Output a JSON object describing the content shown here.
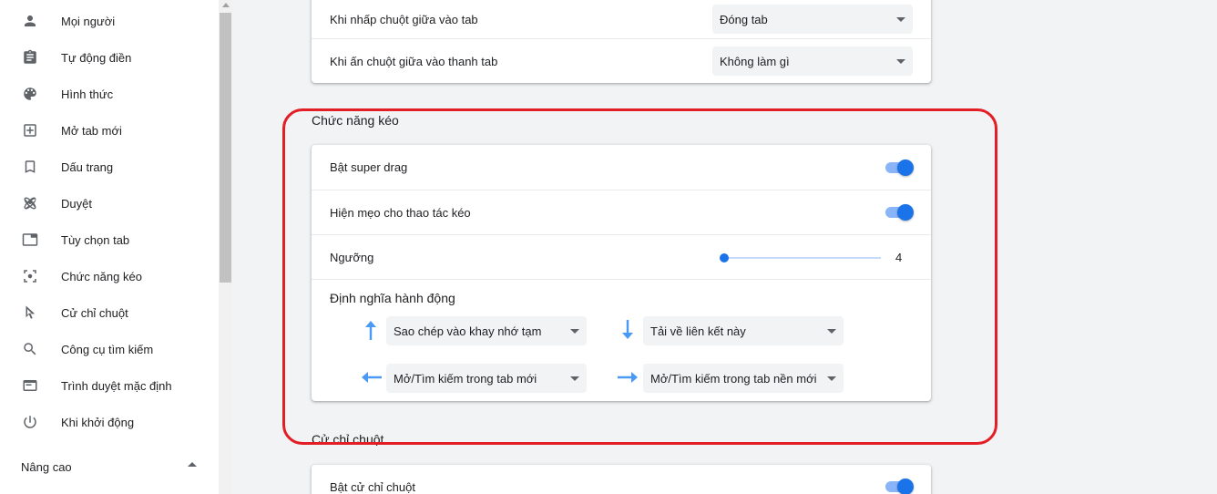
{
  "sidebar": {
    "items": [
      {
        "label": "Mọi người",
        "icon": "person-icon"
      },
      {
        "label": "Tự động điền",
        "icon": "clipboard-icon"
      },
      {
        "label": "Hình thức",
        "icon": "palette-icon"
      },
      {
        "label": "Mở tab mới",
        "icon": "new-tab-icon"
      },
      {
        "label": "Dấu trang",
        "icon": "bookmark-icon"
      },
      {
        "label": "Duyệt",
        "icon": "atom-icon"
      },
      {
        "label": "Tùy chọn tab",
        "icon": "tab-icon"
      },
      {
        "label": "Chức năng kéo",
        "icon": "drag-select-icon"
      },
      {
        "label": "Cử chỉ chuột",
        "icon": "cursor-icon"
      },
      {
        "label": "Công cụ tìm kiếm",
        "icon": "search-icon"
      },
      {
        "label": "Trình duyệt mặc định",
        "icon": "browser-icon"
      },
      {
        "label": "Khi khởi động",
        "icon": "power-icon"
      }
    ],
    "advanced_label": "Nâng cao"
  },
  "tabs_card": {
    "middle_click_tab_label": "Khi nhấp chuột giữa vào tab",
    "middle_click_tab_value": "Đóng tab",
    "middle_click_bar_label": "Khi ấn chuột giữa vào thanh tab",
    "middle_click_bar_value": "Không làm gì"
  },
  "drag_section": {
    "title": "Chức năng kéo",
    "super_drag_label": "Bật super drag",
    "super_drag_on": true,
    "drag_tips_label": "Hiện mẹo cho thao tác kéo",
    "drag_tips_on": true,
    "threshold_label": "Ngưỡng",
    "threshold_value": "4",
    "threshold_fraction": 0.0,
    "actions_title": "Định nghĩa hành động",
    "action_up": "Sao chép vào khay nhớ tạm",
    "action_down": "Tải về liên kết này",
    "action_left": "Mở/Tìm kiếm trong tab mới",
    "action_right": "Mở/Tìm kiếm trong tab nền mới"
  },
  "gesture_section": {
    "title": "Cử chỉ chuột",
    "enable_label": "Bật cử chỉ chuột",
    "enable_on": true
  },
  "colors": {
    "accent": "#1a73e8",
    "highlight_border": "#e31e24",
    "arrow": "#4a9af5"
  }
}
